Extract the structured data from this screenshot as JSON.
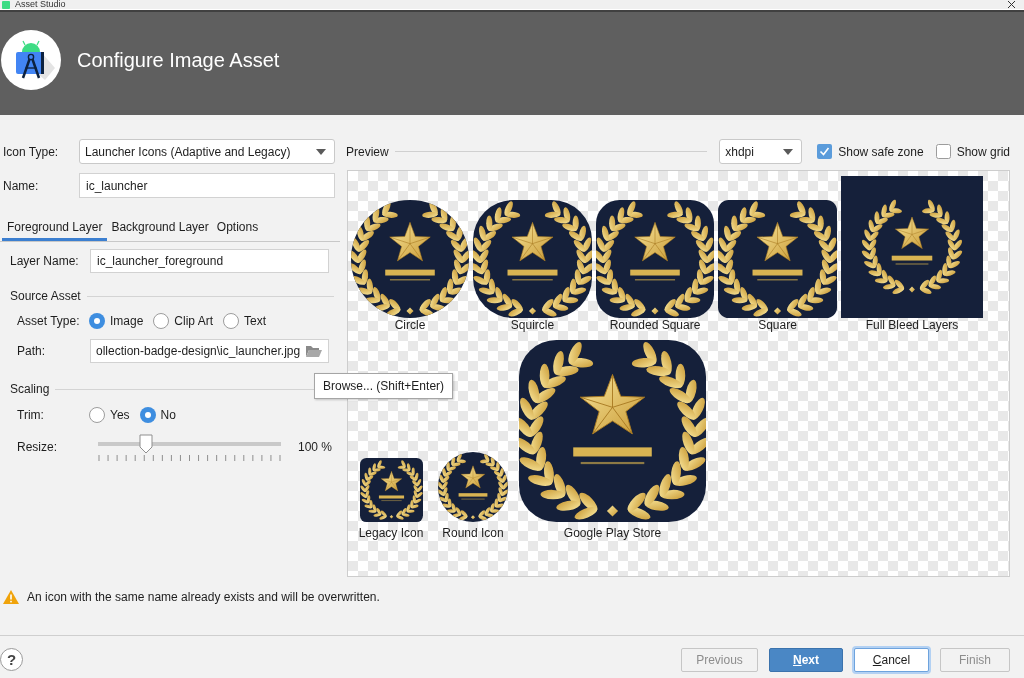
{
  "window": {
    "title": "Asset Studio"
  },
  "header": {
    "title": "Configure Image Asset"
  },
  "icon_type": {
    "label": "Icon Type:",
    "value": "Launcher Icons (Adaptive and Legacy)"
  },
  "name": {
    "label": "Name:",
    "value": "ic_launcher"
  },
  "tabs": [
    {
      "label": "Foreground Layer",
      "selected": true
    },
    {
      "label": "Background Layer",
      "selected": false
    },
    {
      "label": "Options",
      "selected": false
    }
  ],
  "layer_name": {
    "label": "Layer Name:",
    "value": "ic_launcher_foreground"
  },
  "source_asset": {
    "title": "Source Asset",
    "asset_type": {
      "label": "Asset Type:",
      "options": [
        {
          "label": "Image",
          "selected": true
        },
        {
          "label": "Clip Art",
          "selected": false
        },
        {
          "label": "Text",
          "selected": false
        }
      ]
    },
    "path": {
      "label": "Path:",
      "value": "ollection-badge-design\\ic_launcher.jpg"
    }
  },
  "scaling": {
    "title": "Scaling",
    "trim": {
      "label": "Trim:",
      "options": [
        {
          "label": "Yes",
          "selected": false
        },
        {
          "label": "No",
          "selected": true
        }
      ]
    },
    "resize": {
      "label": "Resize:",
      "level": 0.26,
      "reading": "100 %"
    }
  },
  "tooltip": {
    "text": "Browse... (Shift+Enter)"
  },
  "preview": {
    "title": "Preview",
    "density": "xhdpi",
    "show_safe_zone": {
      "label": "Show safe zone",
      "checked": true
    },
    "show_grid": {
      "label": "Show grid",
      "checked": false
    },
    "rows": [
      [
        {
          "label": "Circle",
          "kind": "circle"
        },
        {
          "label": "Squircle",
          "kind": "squircle"
        },
        {
          "label": "Rounded Square",
          "kind": "rounded_square"
        },
        {
          "label": "Square",
          "kind": "square"
        },
        {
          "label": "Full Bleed Layers",
          "kind": "full_bleed"
        }
      ],
      [
        {
          "label": "Legacy Icon",
          "kind": "legacy"
        },
        {
          "label": "Round Icon",
          "kind": "round"
        },
        {
          "label": "Google Play Store",
          "kind": "play_store"
        }
      ]
    ]
  },
  "warning": {
    "text": "An icon with the same name already exists and will be overwritten."
  },
  "help_button": "?",
  "buttons": [
    {
      "label": "Previous",
      "kind": "secondary",
      "disabled": true,
      "focused": false,
      "mnemonic": false
    },
    {
      "label": "Next",
      "kind": "primary",
      "disabled": false,
      "focused": false,
      "mnemonic": true
    },
    {
      "label": "Cancel",
      "kind": "secondary",
      "disabled": false,
      "focused": true,
      "mnemonic": true
    },
    {
      "label": "Finish",
      "kind": "secondary",
      "disabled": true,
      "focused": false,
      "mnemonic": false
    }
  ]
}
